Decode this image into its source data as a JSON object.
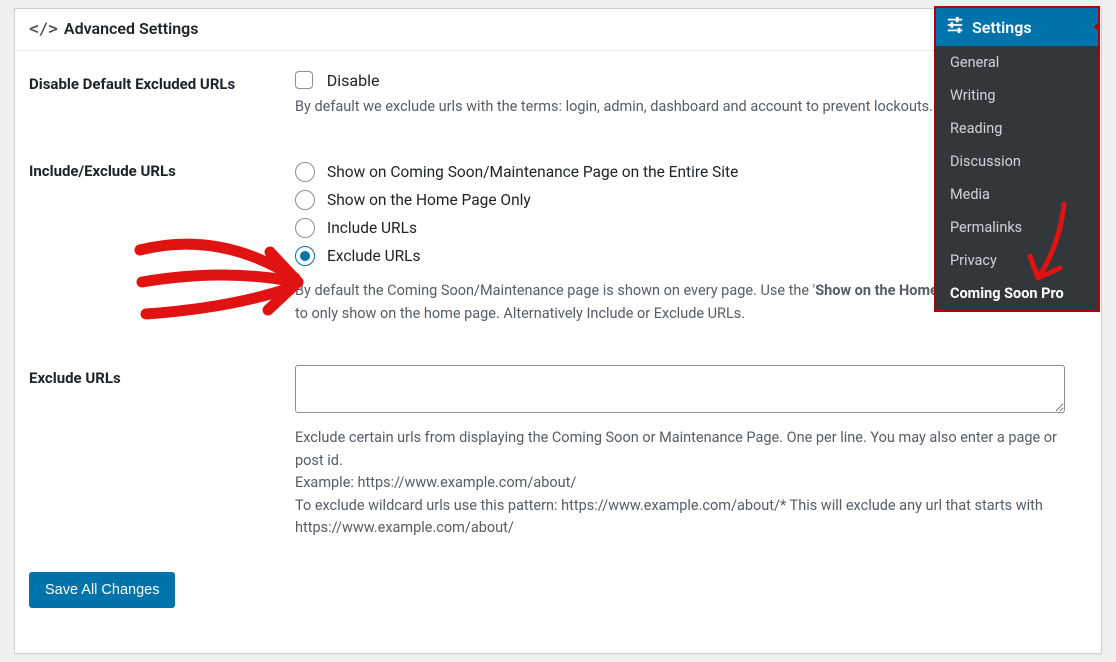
{
  "panel": {
    "title": "Advanced Settings"
  },
  "row_disable": {
    "label": "Disable Default Excluded URLs",
    "checkbox_label": "Disable",
    "description": "By default we exclude urls with the terms: login, admin, dashboard and account to prevent lockouts."
  },
  "row_include_exclude": {
    "label": "Include/Exclude URLs",
    "options": [
      "Show on Coming Soon/Maintenance Page on the Entire Site",
      "Show on the Home Page Only",
      "Include URLs",
      "Exclude URLs"
    ],
    "selected_index": 3,
    "description_pre": "By default the Coming Soon/Maintenance page is shown on every page. Use the '",
    "description_bold": "Show on the Home Page Only",
    "description_post": "' option to only show on the home page. Alternatively Include or Exclude URLs."
  },
  "row_exclude": {
    "label": "Exclude URLs",
    "textarea_value": "",
    "help1": "Exclude certain urls from displaying the Coming Soon or Maintenance Page. One per line. You may also enter a page or post id.",
    "help2": "Example: https://www.example.com/about/",
    "help3": "To exclude wildcard urls use this pattern: https://www.example.com/about/* This will exclude any url that starts with https://www.example.com/about/"
  },
  "save_button": "Save All Changes",
  "flyout": {
    "title": "Settings",
    "items": [
      "General",
      "Writing",
      "Reading",
      "Discussion",
      "Media",
      "Permalinks",
      "Privacy",
      "Coming Soon Pro"
    ],
    "active_index": 7
  },
  "annotation_colors": {
    "arrow": "#e11212"
  }
}
